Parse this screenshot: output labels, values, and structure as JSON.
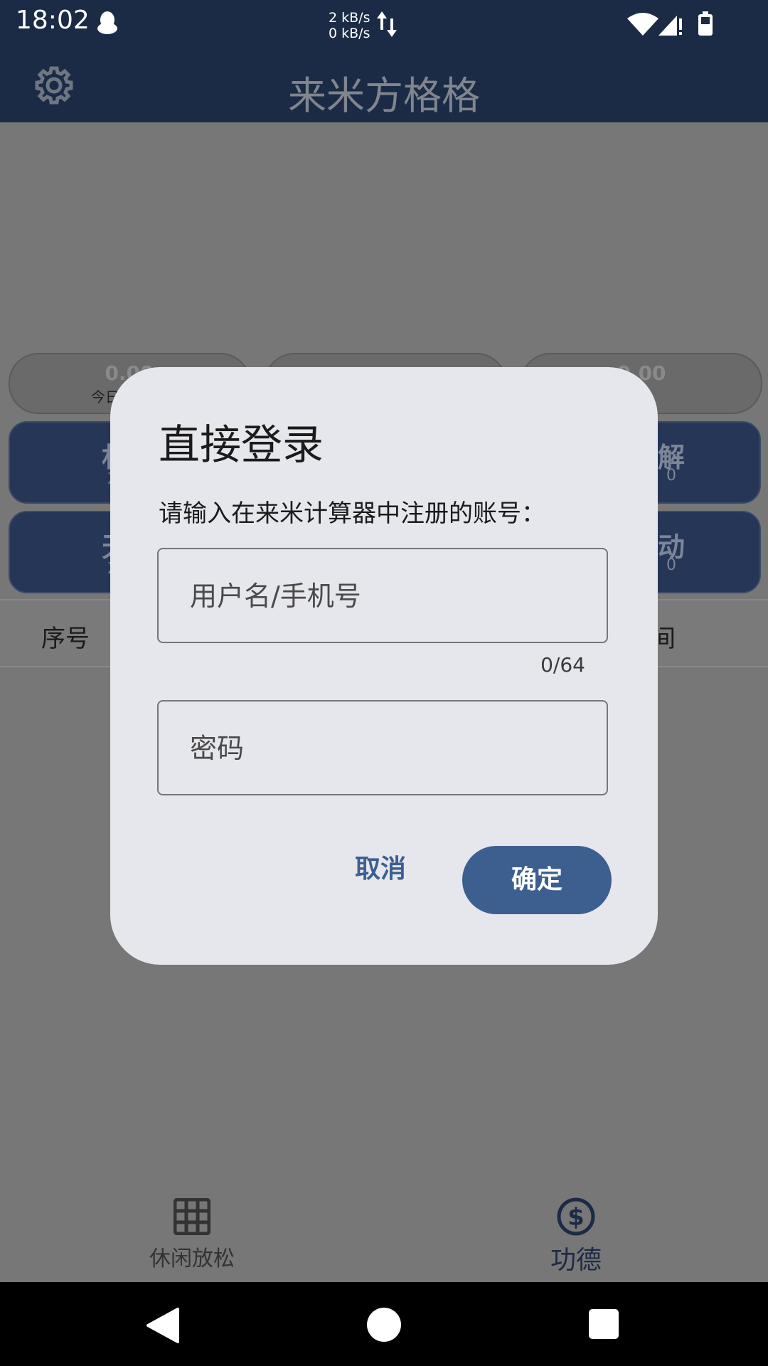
{
  "status_bar": {
    "time": "18:02",
    "net_up": "2 kB/s",
    "net_down": "0 kB/s"
  },
  "app_bar": {
    "title": "来米方格格"
  },
  "background": {
    "stats": [
      {
        "value": "0.00",
        "label": "今日"
      },
      {
        "value": "",
        "label": ""
      },
      {
        "value": "0.00",
        "label": ""
      }
    ],
    "cards_left": [
      {
        "big": "村",
        "small": "次"
      },
      {
        "big": "天",
        "small": "次"
      }
    ],
    "cards_right": [
      {
        "big": "解",
        "small": "0"
      },
      {
        "big": "动",
        "small": "0"
      }
    ],
    "table_headers": [
      "序号",
      "间"
    ]
  },
  "dialog": {
    "title": "直接登录",
    "prompt": "请输入在来米计算器中注册的账号：",
    "username_placeholder": "用户名/手机号",
    "username_value": "",
    "username_counter": "0/64",
    "password_placeholder": "密码",
    "password_value": "",
    "cancel_label": "取消",
    "confirm_label": "确定"
  },
  "bottom_nav": {
    "left_label": "休闲放松",
    "right_label": "功德"
  },
  "colors": {
    "primary": "#1c2b45",
    "accent": "#3c5f90",
    "dialog_bg": "#e6e7ed",
    "scrim": "#777777"
  }
}
